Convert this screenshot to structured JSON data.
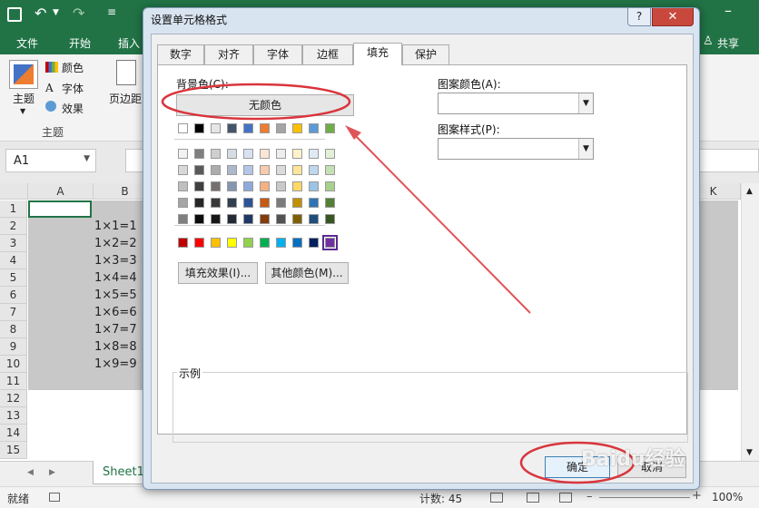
{
  "excel": {
    "tabs": [
      "文件",
      "开始",
      "插入"
    ],
    "share_label": "共享",
    "ribbon": {
      "theme_label": "主题",
      "colors_label": "颜色",
      "fonts_label": "字体",
      "effects_label": "效果",
      "margins_label": "页边距",
      "group_label": "主题"
    },
    "name_box": "A1",
    "columns": [
      "A",
      "B",
      "K"
    ],
    "rows": [
      "1",
      "2",
      "3",
      "4",
      "5",
      "6",
      "7",
      "8",
      "9",
      "10",
      "11",
      "12",
      "13",
      "14",
      "15"
    ],
    "cells_b": [
      "1×1=1",
      "1×2=2",
      "1×3=3",
      "1×4=4",
      "1×5=5",
      "1×6=6",
      "1×7=7",
      "1×8=8",
      "1×9=9"
    ],
    "sheet_tab": "Sheet1",
    "status_ready": "就绪",
    "status_count": "计数: 45",
    "zoom": "100%"
  },
  "dialog": {
    "title": "设置单元格格式",
    "help_label": "?",
    "close_label": "✕",
    "tabs": [
      "数字",
      "对齐",
      "字体",
      "边框",
      "填充",
      "保护"
    ],
    "active_tab": "填充",
    "bg_color_label": "背景色(C):",
    "no_color_label": "无颜色",
    "fill_effects_label": "填充效果(I)...",
    "more_colors_label": "其他颜色(M)...",
    "pattern_color_label": "图案颜色(A):",
    "pattern_style_label": "图案样式(P):",
    "sample_label": "示例",
    "ok_label": "确定",
    "cancel_label": "取消"
  },
  "palette": {
    "row0": [
      "#ffffff",
      "#000000",
      "#e7e6e6",
      "#44546a",
      "#4472c4",
      "#ed7d31",
      "#a5a5a5",
      "#ffc000",
      "#5b9bd5",
      "#70ad47"
    ],
    "tints": [
      [
        "#f2f2f2",
        "#7f7f7f",
        "#d0cece",
        "#d6dce4",
        "#d9e2f3",
        "#fbe5d5",
        "#ededed",
        "#fff2cc",
        "#deebf6",
        "#e2efd9"
      ],
      [
        "#d8d8d8",
        "#595959",
        "#aeabab",
        "#adb9ca",
        "#b4c6e7",
        "#f7cbac",
        "#dbdbdb",
        "#fee599",
        "#bdd7ee",
        "#c5e0b3"
      ],
      [
        "#bfbfbf",
        "#3f3f3f",
        "#757070",
        "#8496b0",
        "#8eaadb",
        "#f4b183",
        "#c9c9c9",
        "#ffd965",
        "#9cc3e5",
        "#a8d08d"
      ],
      [
        "#a5a5a5",
        "#262626",
        "#3a3838",
        "#323f4f",
        "#2f5496",
        "#c55a11",
        "#7b7b7b",
        "#bf9000",
        "#2e75b5",
        "#538135"
      ],
      [
        "#7f7f7f",
        "#0c0c0c",
        "#171616",
        "#222a35",
        "#1f3864",
        "#833c0b",
        "#525252",
        "#7f6000",
        "#1e4e79",
        "#375623"
      ]
    ],
    "standard": [
      "#c00000",
      "#ff0000",
      "#ffc000",
      "#ffff00",
      "#92d050",
      "#00b050",
      "#00b0f0",
      "#0070c0",
      "#002060",
      "#7030a0"
    ]
  },
  "watermark": "Baidu经验"
}
